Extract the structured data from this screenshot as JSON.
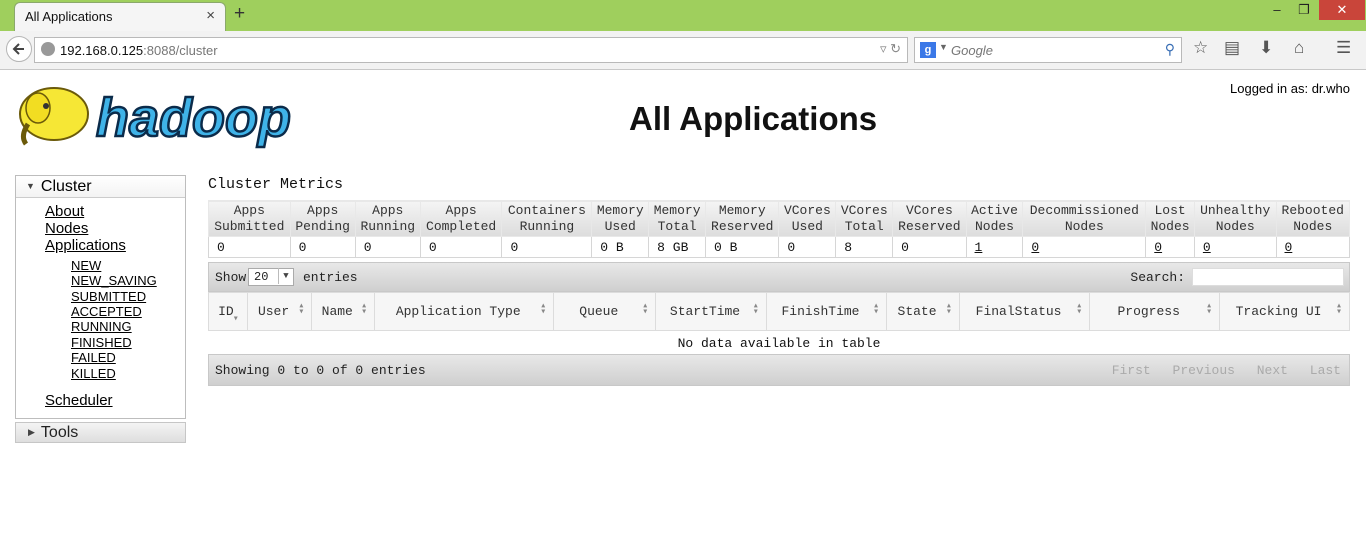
{
  "browser": {
    "tab_title": "All Applications",
    "tab_close": "×",
    "new_tab": "+",
    "url_host": "192.168.0.125",
    "url_rest": ":8088/cluster",
    "search_engine_badge": "g",
    "search_placeholder": "Google",
    "win_min": "–",
    "win_max": "❐",
    "win_close": "✕"
  },
  "header": {
    "logged_in": "Logged in as: dr.who",
    "title": "All Applications",
    "logo_text": "hadoop"
  },
  "sidebar": {
    "cluster_label": "Cluster",
    "links": [
      "About",
      "Nodes",
      "Applications"
    ],
    "app_states": [
      "NEW",
      "NEW_SAVING",
      "SUBMITTED",
      "ACCEPTED",
      "RUNNING",
      "FINISHED",
      "FAILED",
      "KILLED"
    ],
    "scheduler": "Scheduler",
    "tools_label": "Tools"
  },
  "metrics": {
    "title": "Cluster Metrics",
    "headers": [
      [
        "Apps",
        "Submitted"
      ],
      [
        "Apps",
        "Pending"
      ],
      [
        "Apps",
        "Running"
      ],
      [
        "Apps",
        "Completed"
      ],
      [
        "Containers",
        "Running"
      ],
      [
        "Memory",
        "Used"
      ],
      [
        "Memory",
        "Total"
      ],
      [
        "Memory",
        "Reserved"
      ],
      [
        "VCores",
        "Used"
      ],
      [
        "VCores",
        "Total"
      ],
      [
        "VCores",
        "Reserved"
      ],
      [
        "Active",
        "Nodes"
      ],
      [
        "Decommissioned",
        "Nodes"
      ],
      [
        "Lost",
        "Nodes"
      ],
      [
        "Unhealthy",
        "Nodes"
      ],
      [
        "Rebooted",
        "Nodes"
      ]
    ],
    "values": [
      "0",
      "0",
      "0",
      "0",
      "0",
      "0 B",
      "8 GB",
      "0 B",
      "0",
      "8",
      "0",
      "1",
      "0",
      "0",
      "0",
      "0"
    ]
  },
  "apps_table": {
    "show_label": "Show",
    "page_size": "20",
    "entries_label": "entries",
    "search_label": "Search:",
    "columns": [
      "ID",
      "User",
      "Name",
      "Application Type",
      "Queue",
      "StartTime",
      "FinishTime",
      "State",
      "FinalStatus",
      "Progress",
      "Tracking UI"
    ],
    "empty_message": "No data available in table",
    "footer_info": "Showing 0 to 0 of 0 entries",
    "pager": [
      "First",
      "Previous",
      "Next",
      "Last"
    ]
  }
}
